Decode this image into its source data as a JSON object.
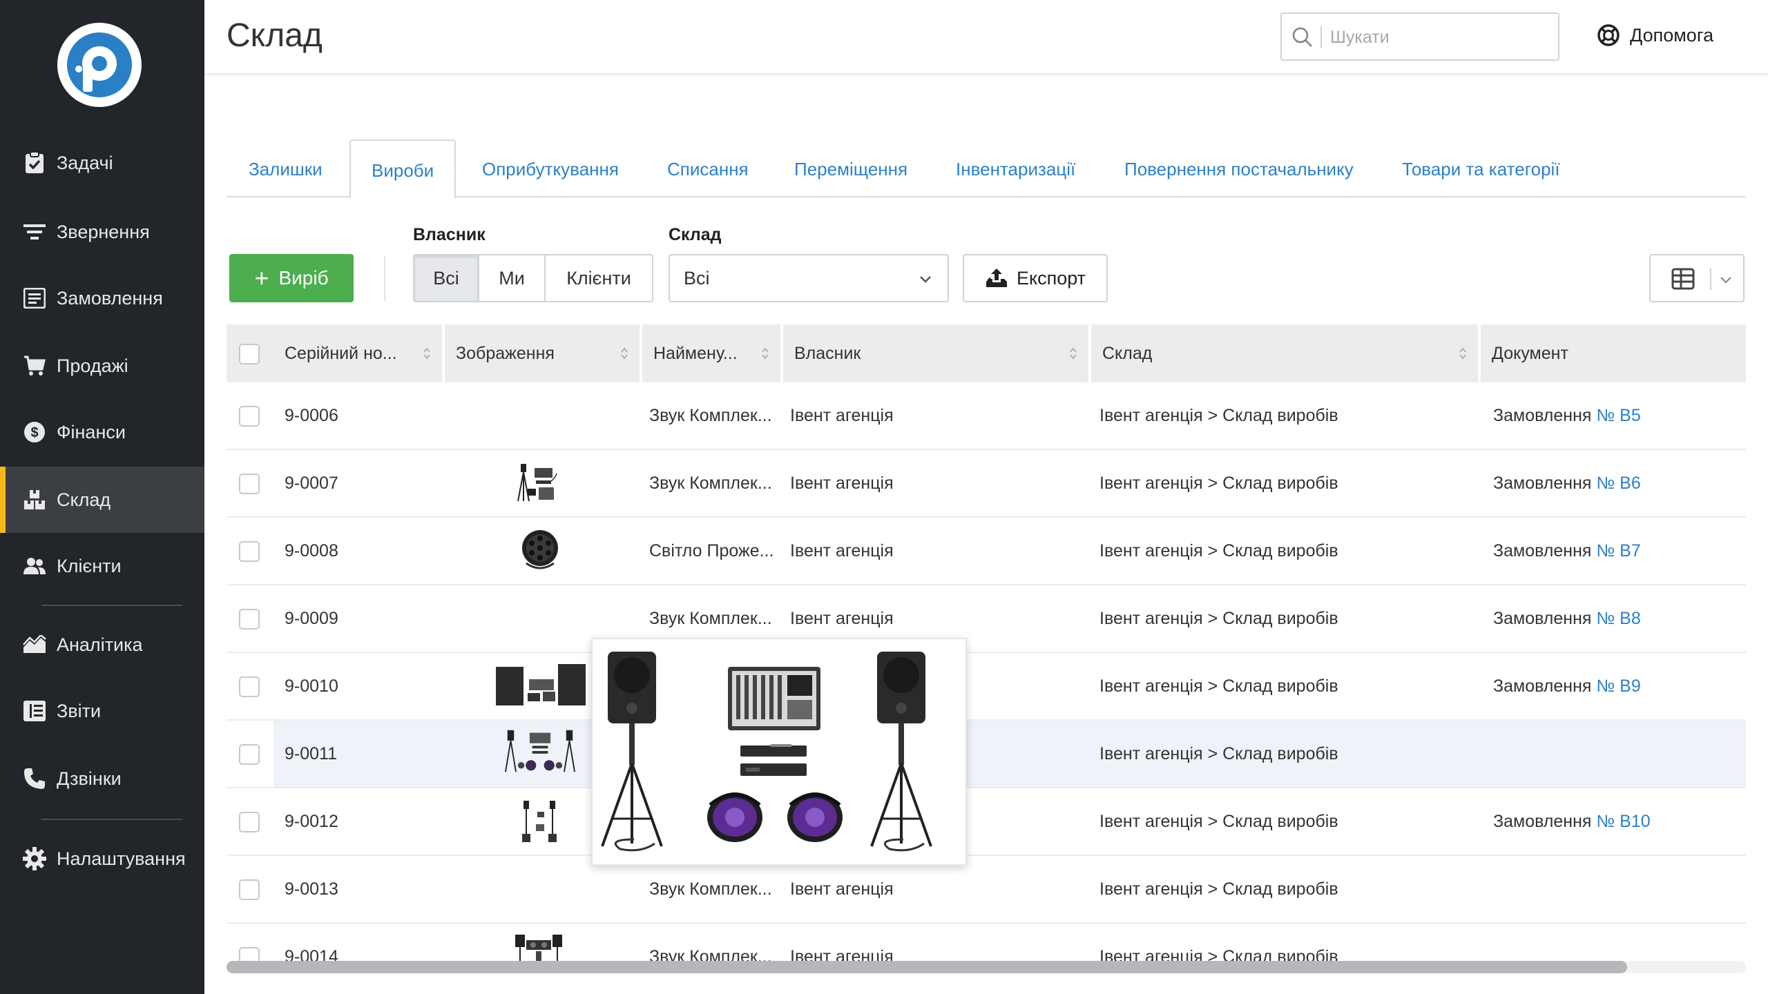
{
  "sidebar": {
    "logo": "remonline-logo",
    "items": [
      {
        "label": "Задачі",
        "icon": "clipboard-check-icon",
        "active": false
      },
      {
        "label": "Звернення",
        "icon": "filter-lines-icon",
        "active": false
      },
      {
        "label": "Замовлення",
        "icon": "order-list-icon",
        "active": false
      },
      {
        "label": "Продажі",
        "icon": "cart-icon",
        "active": false
      },
      {
        "label": "Фінанси",
        "icon": "dollar-circle-icon",
        "active": false
      },
      {
        "label": "Склад",
        "icon": "boxes-icon",
        "active": true
      },
      {
        "label": "Клієнти",
        "icon": "people-icon",
        "active": false
      },
      {
        "label": "Аналітика",
        "icon": "area-chart-icon",
        "active": false
      },
      {
        "label": "Звіти",
        "icon": "report-list-icon",
        "active": false
      },
      {
        "label": "Дзвінки",
        "icon": "phone-icon",
        "active": false
      },
      {
        "label": "Налаштування",
        "icon": "gear-icon",
        "active": false
      }
    ]
  },
  "header": {
    "title": "Склад",
    "search_placeholder": "Шукати",
    "help_label": "Допомога"
  },
  "tabs": [
    {
      "label": "Залишки",
      "active": false
    },
    {
      "label": "Вироби",
      "active": true
    },
    {
      "label": "Оприбуткування",
      "active": false
    },
    {
      "label": "Списання",
      "active": false
    },
    {
      "label": "Переміщення",
      "active": false
    },
    {
      "label": "Інвентаризації",
      "active": false
    },
    {
      "label": "Повернення постачальнику",
      "active": false
    },
    {
      "label": "Товари та категорії",
      "active": false
    }
  ],
  "toolbar": {
    "add_label": "Виріб",
    "owner_label": "Власник",
    "owner_options": [
      "Всі",
      "Ми",
      "Клієнти"
    ],
    "owner_selected": "Всі",
    "warehouse_label": "Склад",
    "warehouse_value": "Всі",
    "export_label": "Експорт"
  },
  "table": {
    "columns": [
      "Серійний но...",
      "Зображення",
      "Наймену...",
      "Власник",
      "Склад",
      "Документ"
    ],
    "rows": [
      {
        "serial": "9-0006",
        "image": "",
        "name": "Звук Комплек...",
        "owner": "Івент агенція",
        "warehouse": "Івент агенція > Склад виробів",
        "doc_prefix": "Замовлення",
        "doc_number": "№ B5"
      },
      {
        "serial": "9-0007",
        "image": "sound-kit-thumbnail",
        "name": "Звук Комплек...",
        "owner": "Івент агенція",
        "warehouse": "Івент агенція > Склад виробів",
        "doc_prefix": "Замовлення",
        "doc_number": "№ B6"
      },
      {
        "serial": "9-0008",
        "image": "spotlight-thumbnail",
        "name": "Світло Проже...",
        "owner": "Івент агенція",
        "warehouse": "Івент агенція > Склад виробів",
        "doc_prefix": "Замовлення",
        "doc_number": "№ B7"
      },
      {
        "serial": "9-0009",
        "image": "",
        "name": "Звук Комплек...",
        "owner": "Івент агенція",
        "warehouse": "Івент агенція > Склад виробів",
        "doc_prefix": "Замовлення",
        "doc_number": "№ B8"
      },
      {
        "serial": "9-0010",
        "image": "speakers-mixer-thumbnail",
        "name": "",
        "owner": "",
        "warehouse": "Івент агенція > Склад виробів",
        "doc_prefix": "Замовлення",
        "doc_number": "№ B9"
      },
      {
        "serial": "9-0011",
        "image": "full-kit-thumbnail",
        "name": "",
        "owner": "",
        "warehouse": "Івент агенція > Склад виробів",
        "doc_prefix": "",
        "doc_number": ""
      },
      {
        "serial": "9-0012",
        "image": "speaker-stands-thumbnail",
        "name": "",
        "owner": "",
        "warehouse": "Івент агенція > Склад виробів",
        "doc_prefix": "Замовлення",
        "doc_number": "№ B10"
      },
      {
        "serial": "9-0013",
        "image": "",
        "name": "Звук Комплек...",
        "owner": "Івент агенція",
        "warehouse": "Івент агенція > Склад виробів",
        "doc_prefix": "",
        "doc_number": ""
      },
      {
        "serial": "9-0014",
        "image": "dj-setup-thumbnail",
        "name": "Звук Комплек...",
        "owner": "Івент агенція",
        "warehouse": "Івент агенція > Склад виробів",
        "doc_prefix": "",
        "doc_number": ""
      }
    ],
    "highlighted_row": "9-0011",
    "preview_image": "full-kit-preview"
  },
  "colors": {
    "sidebar_bg": "#222529",
    "active_accent": "#f5b817",
    "link": "#2d80c8",
    "add_button": "#4cae4f"
  }
}
